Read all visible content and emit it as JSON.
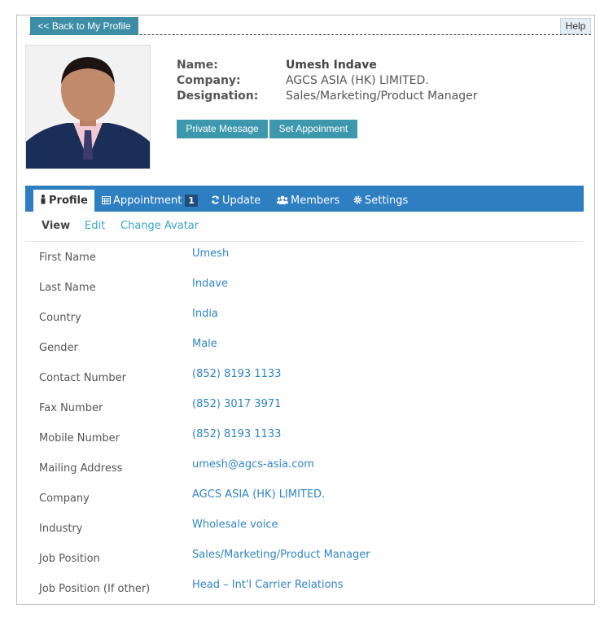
{
  "nav": {
    "back_label": "<< Back to My Profile",
    "help_label": "Help"
  },
  "header": {
    "name_label": "Name:",
    "name_value": "Umesh Indave",
    "company_label": "Company:",
    "company_value": "AGCS ASIA (HK) LIMITED.",
    "designation_label": "Designation:",
    "designation_value": "Sales/Marketing/Product Manager",
    "buttons": {
      "private_message": "Private Message",
      "set_appointment": "Set Appoinment"
    }
  },
  "tabs": [
    {
      "label": "Profile",
      "icon": "person-icon",
      "active": true
    },
    {
      "label": "Appointment",
      "icon": "calendar-icon",
      "badge": "1"
    },
    {
      "label": "Update",
      "icon": "refresh-icon"
    },
    {
      "label": "Members",
      "icon": "users-icon"
    },
    {
      "label": "Settings",
      "icon": "gear-icon"
    }
  ],
  "subnav": {
    "view": "View",
    "edit": "Edit",
    "change_avatar": "Change Avatar"
  },
  "fields": [
    {
      "label": "First Name",
      "value": "Umesh"
    },
    {
      "label": "Last Name",
      "value": "Indave"
    },
    {
      "label": "Country",
      "value": "India"
    },
    {
      "label": "Gender",
      "value": "Male"
    },
    {
      "label": "Contact Number",
      "value": "(852) 8193 1133"
    },
    {
      "label": "Fax Number",
      "value": "(852) 3017 3971"
    },
    {
      "label": "Mobile Number",
      "value": "(852) 8193 1133"
    },
    {
      "label": "Mailing Address",
      "value": "umesh@agcs-asia.com"
    },
    {
      "label": "Company",
      "value": "AGCS ASIA (HK) LIMITED."
    },
    {
      "label": "Industry",
      "value": "Wholesale voice"
    },
    {
      "label": "Job Position",
      "value": "Sales/Marketing/Product Manager"
    },
    {
      "label": "Job Position (If other)",
      "value": "Head – Int'l Carrier Relations"
    }
  ],
  "colors": {
    "accent": "#2e7fc2",
    "button": "#3d97ad",
    "link": "#2f86c2"
  }
}
